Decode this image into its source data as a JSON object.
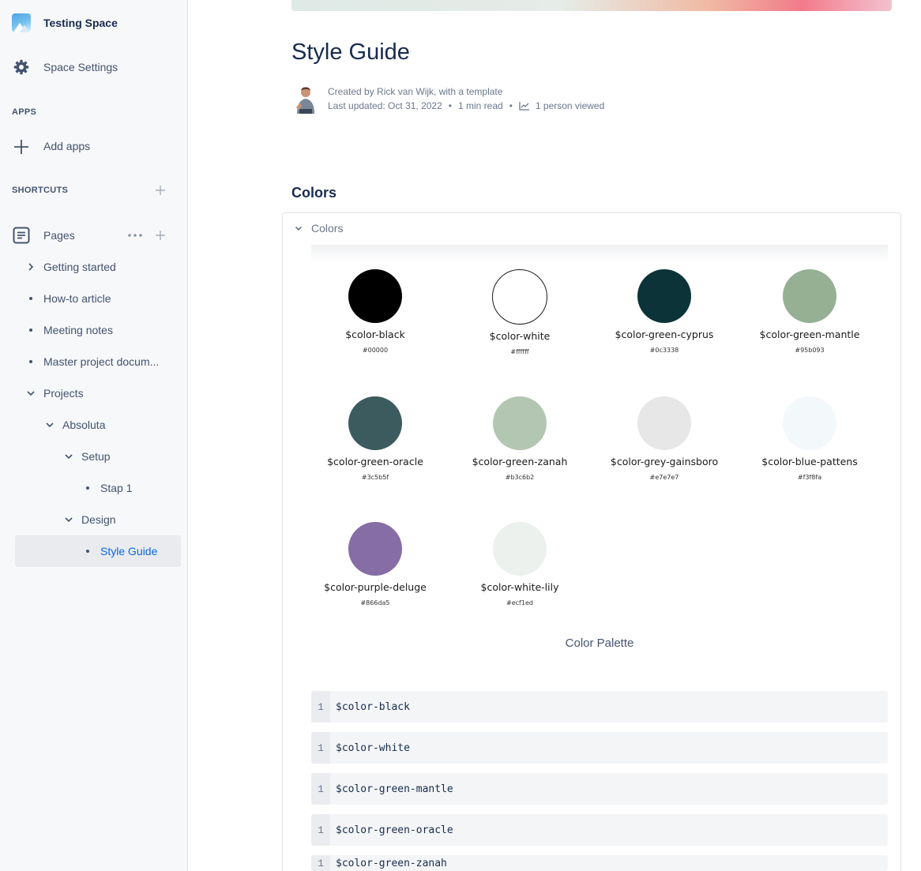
{
  "sidebar": {
    "space_name": "Testing Space",
    "space_settings": "Space Settings",
    "apps_heading": "APPS",
    "add_apps": "Add apps",
    "shortcuts_heading": "SHORTCUTS",
    "pages_label": "Pages",
    "tree": [
      {
        "label": "Getting started",
        "marker": "chevron-right"
      },
      {
        "label": "How-to article",
        "marker": "bullet"
      },
      {
        "label": "Meeting notes",
        "marker": "bullet"
      },
      {
        "label": "Master project docum...",
        "marker": "bullet"
      },
      {
        "label": "Projects",
        "marker": "chevron-down"
      },
      {
        "label": "Absoluta",
        "marker": "chevron-down"
      },
      {
        "label": "Setup",
        "marker": "chevron-down"
      },
      {
        "label": "Stap 1",
        "marker": "bullet"
      },
      {
        "label": "Design",
        "marker": "chevron-down"
      },
      {
        "label": "Style Guide",
        "marker": "bullet",
        "selected": true
      }
    ]
  },
  "page": {
    "title": "Style Guide",
    "created_by": "Created by Rick van Wijk, with a template",
    "last_updated": "Last updated: Oct 31, 2022",
    "read_time": "1 min read",
    "viewed": "1 person viewed",
    "section_heading": "Colors",
    "expand_title": "Colors",
    "palette_caption": "Color Palette"
  },
  "swatches": [
    {
      "name": "$color-black",
      "hex": "#00000",
      "color": "#000000"
    },
    {
      "name": "$color-white",
      "hex": "#ffffff",
      "color": "#ffffff",
      "outlined": true
    },
    {
      "name": "$color-green-cyprus",
      "hex": "#0c3338",
      "color": "#0c3338"
    },
    {
      "name": "$color-green-mantle",
      "hex": "#95b093",
      "color": "#95b093"
    },
    {
      "name": "$color-green-oracle",
      "hex": "#3c5b5f",
      "color": "#3c5b5f"
    },
    {
      "name": "$color-green-zanah",
      "hex": "#b3c6b2",
      "color": "#b3c6b2"
    },
    {
      "name": "$color-grey-gainsboro",
      "hex": "#e7e7e7",
      "color": "#e7e7e7"
    },
    {
      "name": "$color-blue-pattens",
      "hex": "#f3f8fa",
      "color": "#f3f8fa"
    },
    {
      "name": "$color-purple-deluge",
      "hex": "#866da5",
      "color": "#866da5"
    },
    {
      "name": "$color-white-lily",
      "hex": "#ecf1ed",
      "color": "#ecf1ed"
    }
  ],
  "code_blocks": [
    {
      "line": "1",
      "code": "$color-black"
    },
    {
      "line": "1",
      "code": "$color-white"
    },
    {
      "line": "1",
      "code": "$color-green-mantle"
    },
    {
      "line": "1",
      "code": "$color-green-oracle"
    },
    {
      "line": "1",
      "code": "$color-green-zanah"
    }
  ]
}
